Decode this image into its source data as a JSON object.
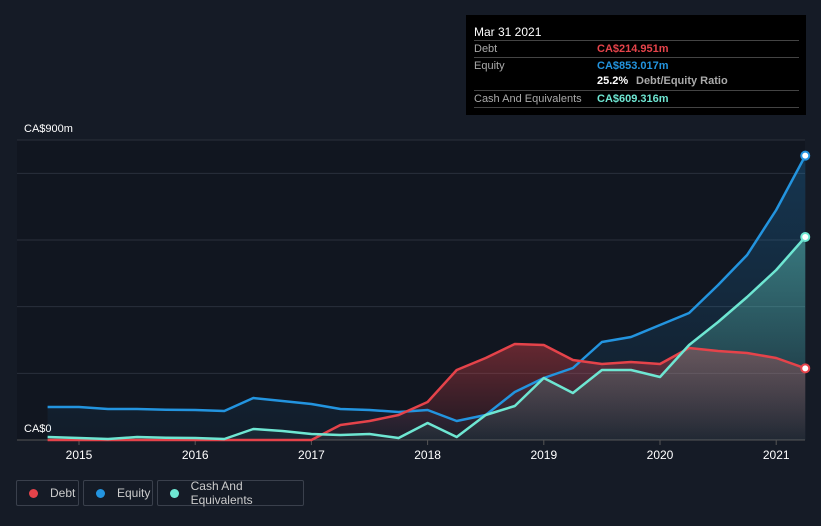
{
  "tooltip": {
    "date": "Mar 31 2021",
    "debt_label": "Debt",
    "debt_value": "CA$214.951m",
    "equity_label": "Equity",
    "equity_value": "CA$853.017m",
    "ratio_value": "25.2%",
    "ratio_label": "Debt/Equity Ratio",
    "cash_label": "Cash And Equivalents",
    "cash_value": "CA$609.316m"
  },
  "legend": [
    {
      "label": "Debt",
      "color": "#e5434a"
    },
    {
      "label": "Equity",
      "color": "#2394df"
    },
    {
      "label": "Cash And Equivalents",
      "color": "#6ee6d2"
    }
  ],
  "chart_data": {
    "type": "area",
    "title": "",
    "xlabel": "",
    "ylabel": "",
    "ylim": [
      0,
      900
    ],
    "xlim": [
      2014.65,
      2021.25
    ],
    "y_tick_labels": [
      "CA$0",
      "CA$900m"
    ],
    "x_tick_labels": [
      "2015",
      "2016",
      "2017",
      "2018",
      "2019",
      "2020",
      "2021"
    ],
    "x": [
      2014.73,
      2015,
      2015.25,
      2015.5,
      2015.75,
      2016,
      2016.25,
      2016.5,
      2016.75,
      2017,
      2017.25,
      2017.5,
      2017.75,
      2018,
      2018.25,
      2018.5,
      2018.75,
      2019,
      2019.25,
      2019.5,
      2019.75,
      2020,
      2020.25,
      2020.5,
      2020.75,
      2021,
      2021.25
    ],
    "series": [
      {
        "name": "Debt",
        "color": "#e5434a",
        "values": [
          0,
          0,
          0,
          0,
          0,
          0,
          0,
          0,
          0,
          0,
          45,
          57,
          75,
          114,
          210,
          246,
          288,
          285,
          240,
          228,
          234,
          228,
          276,
          267,
          261,
          246,
          215
        ]
      },
      {
        "name": "Equity",
        "color": "#2394df",
        "values": [
          99,
          99,
          93,
          93,
          91,
          90,
          87,
          126,
          117,
          108,
          93,
          90,
          84,
          90,
          57,
          75,
          144,
          186,
          216,
          294,
          309,
          345,
          381,
          465,
          555,
          690,
          853
        ]
      },
      {
        "name": "Cash And Equivalents",
        "color": "#6ee6d2",
        "values": [
          9,
          6,
          3,
          9,
          7,
          6,
          3,
          33,
          27,
          18,
          15,
          18,
          6,
          51,
          9,
          75,
          102,
          186,
          141,
          210,
          210,
          189,
          285,
          354,
          429,
          510,
          609
        ]
      }
    ]
  }
}
